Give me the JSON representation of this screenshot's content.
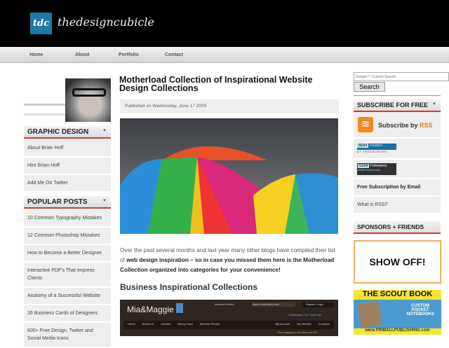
{
  "header": {
    "logo_mark": "tdc",
    "site_name": "thedesigncubicle"
  },
  "nav": [
    "Home",
    "About",
    "Portfolio",
    "Contact"
  ],
  "left": {
    "graphic_design": {
      "title": "GRAPHIC DESIGN",
      "items": [
        "About Brian Hoff",
        "Hire Brian Hoff",
        "Add Me On Twitter"
      ]
    },
    "popular_posts": {
      "title": "POPULAR POSTS",
      "items": [
        "10 Common Typography Mistakes",
        "12 Common Photoshop Mistakes",
        "How to Become a Better Designer",
        "Interactive PDF's That Impress Clients",
        "Anatomy of a Successful Website",
        "26 Business Cards of Designers",
        "600+ Free Design, Twitter and Social Media Icons"
      ]
    }
  },
  "post": {
    "title": "Motherload Collection of Inspirational Website Design Collections",
    "published": "Published on Wednesday, June 17 2009",
    "para_1": "Over the past several months and last year many other blogs have compiled their list of ",
    "para_bold": "web design inspiration – so in case you missed them here is the Motherload Collection organized into categories for your convenience!",
    "heading": "Business Inspirational Collections",
    "shot": {
      "brand": "Mia&Maggie",
      "adv": "Advanced Search",
      "search": "Search entire store here...",
      "login": "Register / Login",
      "tagline": "Celebrating The Good Life",
      "menu": [
        "Home",
        "About Us",
        "Contact",
        "Sizing Chart",
        "Member Photos"
      ],
      "menu_right": [
        "My Account",
        "My Wishlist",
        "Compare"
      ],
      "shipping": "Free shipping on all orders over $75"
    }
  },
  "right": {
    "search_placeholder": "Google™ Custom Search",
    "search_button": "Search",
    "subscribe_title": "SUBSCRIBE FOR FREE",
    "subscribe_by": "Subscribe by ",
    "rss": "RSS",
    "readers_count": "5694",
    "readers_label": "readers",
    "feedburner": "BY FEEDBURNER",
    "followers_count": "5194",
    "followers_label": "Followers",
    "twittercounter": "twittercounter.com",
    "email": "Free Subscription by Email",
    "what_rss": "What is RSS?",
    "sponsors_title": "SPONSORS + FRIENDS",
    "showoff": "SHOW OFF!",
    "scout_title": "THE SCOUT BOOK",
    "scout_tag": "CUSTOM POCKET NOTEBOOKS",
    "scout_url": "www.PINBALLPUBLISHING.com"
  }
}
